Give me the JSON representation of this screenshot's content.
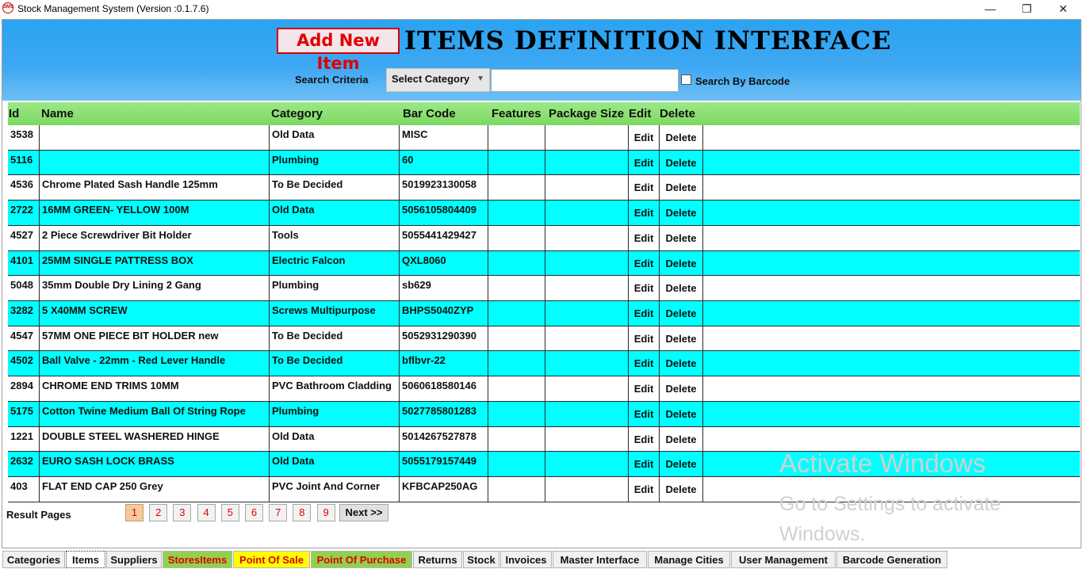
{
  "window": {
    "title": "Stock Management System (Version :0.1.7.6)",
    "icon_text": "SMS",
    "minimize": "—",
    "restore": "❐",
    "close": "✕"
  },
  "header": {
    "add_button": "Add New Item",
    "page_title": "ITEMS DEFINITION INTERFACE",
    "search_label": "Search Criteria",
    "category_select": "Select Category",
    "search_value": "",
    "barcode_checkbox_label": "Search By Barcode",
    "barcode_checked": false
  },
  "grid": {
    "columns": [
      "Id",
      "Name",
      "Category",
      "Bar Code",
      "Features",
      "Package Size",
      "Edit",
      "Delete"
    ],
    "rows": [
      {
        "id": "3538",
        "name": "",
        "category": "Old Data",
        "barcode": "MISC",
        "features": "",
        "package": "",
        "edit": "Edit",
        "delete": "Delete"
      },
      {
        "id": "5116",
        "name": "",
        "category": "Plumbing",
        "barcode": "60",
        "features": "",
        "package": "",
        "edit": "Edit",
        "delete": "Delete"
      },
      {
        "id": "4536",
        "name": " Chrome Plated Sash Handle 125mm",
        "category": "To Be Decided",
        "barcode": "5019923130058",
        "features": "",
        "package": "",
        "edit": "Edit",
        "delete": "Delete"
      },
      {
        "id": "2722",
        "name": "16MM GREEN- YELLOW 100M",
        "category": "Old Data",
        "barcode": "5056105804409",
        "features": "",
        "package": "",
        "edit": "Edit",
        "delete": "Delete"
      },
      {
        "id": "4527",
        "name": "2 Piece Screwdriver Bit Holder",
        "category": "Tools",
        "barcode": "5055441429427",
        "features": "",
        "package": "",
        "edit": "Edit",
        "delete": "Delete"
      },
      {
        "id": "4101",
        "name": "25MM SINGLE PATTRESS BOX",
        "category": "Electric Falcon",
        "barcode": "QXL8060",
        "features": "",
        "package": "",
        "edit": "Edit",
        "delete": "Delete"
      },
      {
        "id": "5048",
        "name": "35mm Double Dry Lining 2 Gang",
        "category": "Plumbing",
        "barcode": "sb629",
        "features": "",
        "package": "",
        "edit": "Edit",
        "delete": "Delete"
      },
      {
        "id": "3282",
        "name": "5 X40MM SCREW",
        "category": "Screws Multipurpose",
        "barcode": "BHPS5040ZYP",
        "features": "",
        "package": "",
        "edit": "Edit",
        "delete": "Delete"
      },
      {
        "id": "4547",
        "name": "57MM ONE PIECE BIT HOLDER new",
        "category": "To Be Decided",
        "barcode": "5052931290390",
        "features": "",
        "package": "",
        "edit": "Edit",
        "delete": "Delete"
      },
      {
        "id": "4502",
        "name": "Ball Valve - 22mm  - Red Lever Handle",
        "category": "To Be Decided",
        "barcode": "bflbvr-22",
        "features": "",
        "package": "",
        "edit": "Edit",
        "delete": "Delete"
      },
      {
        "id": "2894",
        "name": "CHROME END TRIMS 10MM",
        "category": "PVC Bathroom Cladding",
        "barcode": "5060618580146",
        "features": "",
        "package": "",
        "edit": "Edit",
        "delete": "Delete"
      },
      {
        "id": "5175",
        "name": "Cotton Twine Medium Ball Of String Rope",
        "category": "Plumbing",
        "barcode": "5027785801283",
        "features": "",
        "package": "",
        "edit": "Edit",
        "delete": "Delete"
      },
      {
        "id": "1221",
        "name": "DOUBLE STEEL WASHERED HINGE",
        "category": "Old Data",
        "barcode": "5014267527878",
        "features": "",
        "package": "",
        "edit": "Edit",
        "delete": "Delete"
      },
      {
        "id": "2632",
        "name": "EURO SASH LOCK BRASS",
        "category": "Old Data",
        "barcode": "5055179157449",
        "features": "",
        "package": "",
        "edit": "Edit",
        "delete": "Delete"
      },
      {
        "id": "403",
        "name": "FLAT END CAP 250 Grey",
        "category": "PVC Joint And Corner",
        "barcode": "KFBCAP250AG",
        "features": "",
        "package": "",
        "edit": "Edit",
        "delete": "Delete"
      }
    ]
  },
  "pagination": {
    "label": "Result Pages",
    "pages": [
      "1",
      "2",
      "3",
      "4",
      "5",
      "6",
      "7",
      "8",
      "9"
    ],
    "current": "1",
    "next": "Next >>"
  },
  "watermark": {
    "line1": "Activate Windows",
    "line2": "Go to Settings to activate Windows."
  },
  "tabs": [
    {
      "label": "Categories",
      "style": "normal"
    },
    {
      "label": "Items",
      "style": "selected"
    },
    {
      "label": "Suppliers",
      "style": "normal"
    },
    {
      "label": "StoresItems",
      "style": "green"
    },
    {
      "label": "Point Of Sale",
      "style": "yellow"
    },
    {
      "label": "Point Of Purchase",
      "style": "green"
    },
    {
      "label": "Returns",
      "style": "normal"
    },
    {
      "label": "Stock",
      "style": "normal"
    },
    {
      "label": "Invoices",
      "style": "normal"
    },
    {
      "label": "Master Interface",
      "style": "normal"
    },
    {
      "label": "Manage Cities",
      "style": "normal"
    },
    {
      "label": "User Management",
      "style": "normal"
    },
    {
      "label": "Barcode Generation",
      "style": "normal"
    }
  ],
  "colors": {
    "header_bg": "#3fa8f3",
    "grid_header_bg": "#7dd862",
    "alt_row": "#00ffff",
    "accent_red": "#e00000",
    "tab_green": "#92d050",
    "tab_yellow": "#ffff00",
    "page_active": "#f4c99c"
  }
}
